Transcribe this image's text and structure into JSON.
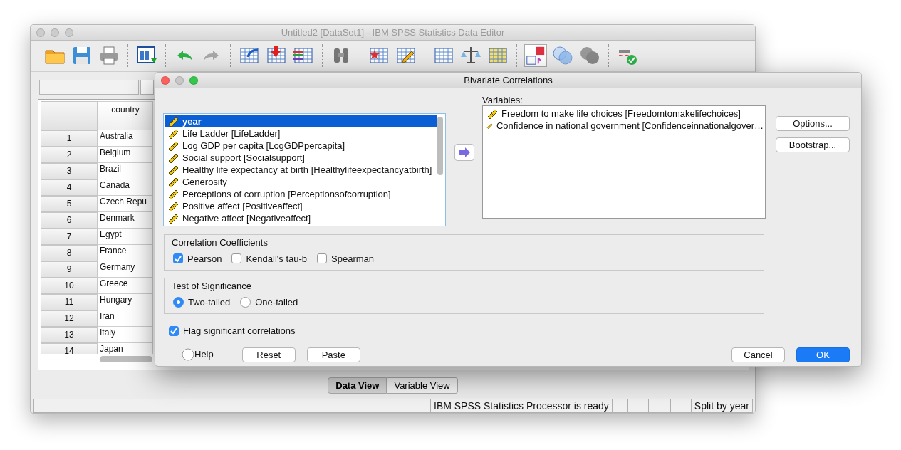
{
  "editor": {
    "title": "Untitled2 [DataSet1] - IBM SPSS Statistics Data Editor",
    "columns": [
      "country"
    ],
    "rows": [
      {
        "number": "1",
        "country": "Australia"
      },
      {
        "number": "2",
        "country": "Belgium"
      },
      {
        "number": "3",
        "country": "Brazil"
      },
      {
        "number": "4",
        "country": "Canada"
      },
      {
        "number": "5",
        "country": "Czech Repu"
      },
      {
        "number": "6",
        "country": "Denmark"
      },
      {
        "number": "7",
        "country": "Egypt"
      },
      {
        "number": "8",
        "country": "France"
      },
      {
        "number": "9",
        "country": "Germany"
      },
      {
        "number": "10",
        "country": "Greece"
      },
      {
        "number": "11",
        "country": "Hungary"
      },
      {
        "number": "12",
        "country": "Iran"
      },
      {
        "number": "13",
        "country": "Italy"
      },
      {
        "number": "14",
        "country": "Japan"
      }
    ],
    "view_tabs": [
      {
        "label": "Data View",
        "selected": true
      },
      {
        "label": "Variable View",
        "selected": false
      }
    ],
    "status_bar": {
      "processor": "IBM SPSS Statistics Processor is ready",
      "split": "Split by year"
    }
  },
  "dialog": {
    "title": "Bivariate Correlations",
    "source_variables": [
      {
        "label": "year",
        "selected": true
      },
      {
        "label": "Life Ladder [LifeLadder]",
        "selected": false
      },
      {
        "label": "Log GDP per capita [LogGDPpercapita]",
        "selected": false
      },
      {
        "label": "Social support [Socialsupport]",
        "selected": false
      },
      {
        "label": "Healthy life expectancy at birth [Healthylifeexpectancyatbirth]",
        "selected": false
      },
      {
        "label": "Generosity",
        "selected": false
      },
      {
        "label": "Perceptions of corruption [Perceptionsofcorruption]",
        "selected": false
      },
      {
        "label": "Positive affect [Positiveaffect]",
        "selected": false
      },
      {
        "label": "Negative affect [Negativeaffect]",
        "selected": false
      }
    ],
    "variables_label": "Variables:",
    "target_variables": [
      "Freedom to make life choices [Freedomtomakelifechoices]",
      "Confidence in national government [Confidenceinnationalgover…"
    ],
    "side_buttons": [
      "Options...",
      "Bootstrap..."
    ],
    "coefficients": {
      "title": "Correlation Coefficients",
      "options": [
        {
          "label": "Pearson",
          "checked": true
        },
        {
          "label": "Kendall's tau-b",
          "checked": false
        },
        {
          "label": "Spearman",
          "checked": false
        }
      ]
    },
    "significance": {
      "title": "Test of Significance",
      "options": [
        {
          "label": "Two-tailed",
          "selected": true
        },
        {
          "label": "One-tailed",
          "selected": false
        }
      ]
    },
    "flag": {
      "label": "Flag significant correlations",
      "checked": true
    },
    "buttons": [
      {
        "label": "Help",
        "kind": "help"
      },
      {
        "label": "Reset",
        "kind": "plain"
      },
      {
        "label": "Paste",
        "kind": "plain"
      },
      {
        "label": "Cancel",
        "kind": "plain"
      },
      {
        "label": "OK",
        "kind": "default"
      }
    ]
  }
}
